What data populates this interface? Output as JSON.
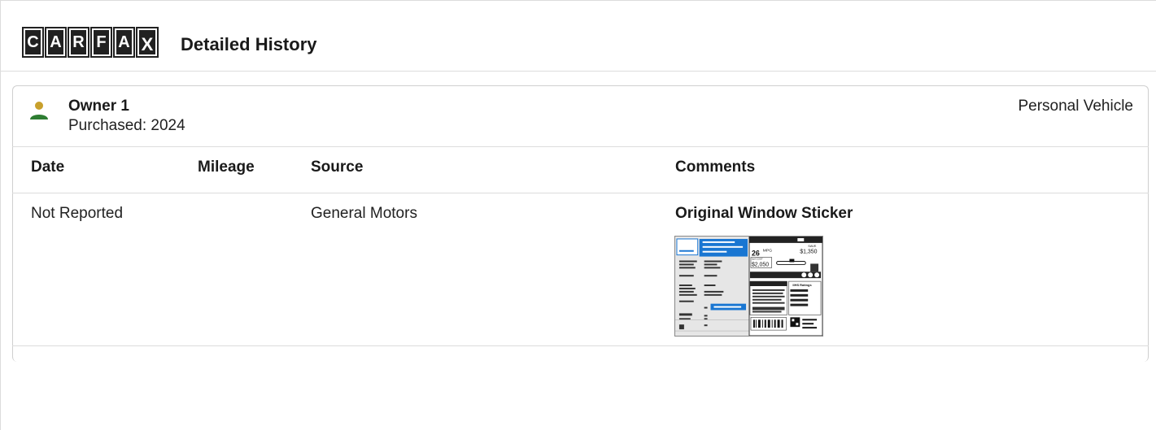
{
  "header": {
    "logo_letters": [
      "C",
      "A",
      "R",
      "F",
      "A",
      "X"
    ],
    "title": "Detailed History"
  },
  "owner": {
    "name": "Owner 1",
    "purchased": "Purchased: 2024",
    "type": "Personal Vehicle",
    "icon": "person-icon",
    "icon_colors": {
      "head": "#c8a02c",
      "body": "#2e7d32"
    }
  },
  "table": {
    "headers": [
      "Date",
      "Mileage",
      "Source",
      "Comments"
    ],
    "rows": [
      {
        "date": "Not Reported",
        "mileage": "",
        "source": "General Motors",
        "comment_title": "Original Window Sticker"
      }
    ]
  },
  "sticker": {
    "mpg": "26",
    "mpg_unit": "MPG",
    "save_label": "SAVE",
    "save_amount": "$1,350",
    "cost_label": "fuel COST",
    "cost_amount": "$2,050",
    "ratings_label": "IIHS Ratings"
  }
}
